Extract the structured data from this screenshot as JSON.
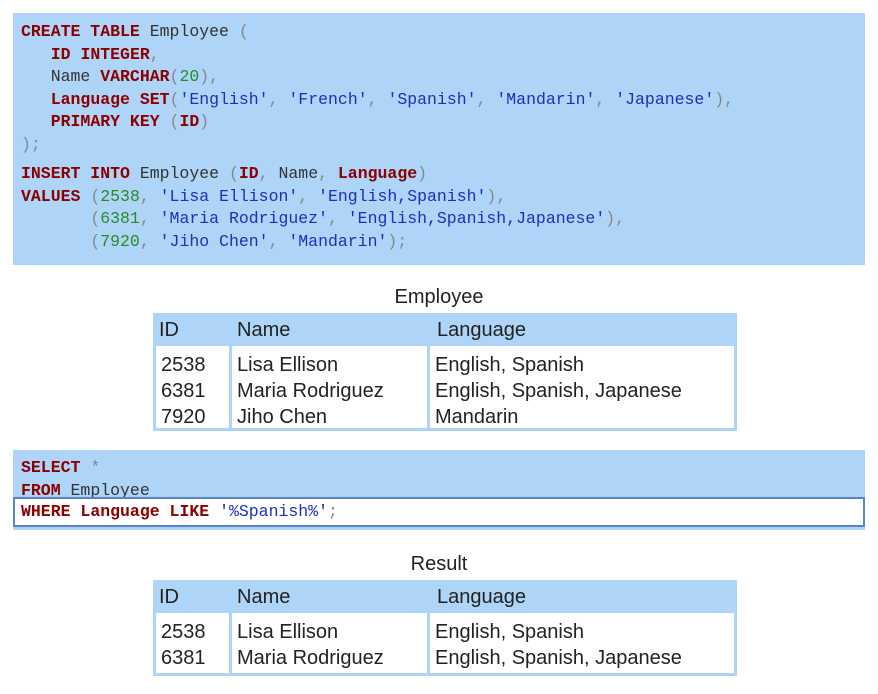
{
  "create_statement": {
    "lines": [
      [
        [
          "kw",
          "CREATE TABLE"
        ],
        [
          "plain",
          " Employee "
        ],
        [
          "punc",
          "("
        ]
      ],
      [
        [
          "plain",
          "   "
        ],
        [
          "kw",
          "ID"
        ],
        [
          "plain",
          " "
        ],
        [
          "kw",
          "INTEGER"
        ],
        [
          "punc",
          ","
        ]
      ],
      [
        [
          "plain",
          "   Name "
        ],
        [
          "kw",
          "VARCHAR"
        ],
        [
          "punc",
          "("
        ],
        [
          "num",
          "20"
        ],
        [
          "punc",
          "),"
        ]
      ],
      [
        [
          "plain",
          "   "
        ],
        [
          "kw",
          "Language"
        ],
        [
          "plain",
          " "
        ],
        [
          "kw",
          "SET"
        ],
        [
          "punc",
          "("
        ],
        [
          "str",
          "'English'"
        ],
        [
          "punc",
          ", "
        ],
        [
          "str",
          "'French'"
        ],
        [
          "punc",
          ", "
        ],
        [
          "str",
          "'Spanish'"
        ],
        [
          "punc",
          ", "
        ],
        [
          "str",
          "'Mandarin'"
        ],
        [
          "punc",
          ", "
        ],
        [
          "str",
          "'Japanese'"
        ],
        [
          "punc",
          "),"
        ]
      ],
      [
        [
          "plain",
          "   "
        ],
        [
          "kw",
          "PRIMARY KEY"
        ],
        [
          "plain",
          " "
        ],
        [
          "punc",
          "("
        ],
        [
          "kw",
          "ID"
        ],
        [
          "punc",
          ")"
        ]
      ],
      [
        [
          "punc",
          ");"
        ]
      ]
    ]
  },
  "insert_statement": {
    "lines": [
      [
        [
          "kw",
          "INSERT INTO"
        ],
        [
          "plain",
          " Employee "
        ],
        [
          "punc",
          "("
        ],
        [
          "kw",
          "ID"
        ],
        [
          "punc",
          ", "
        ],
        [
          "plain",
          "Name"
        ],
        [
          "punc",
          ", "
        ],
        [
          "kw",
          "Language"
        ],
        [
          "punc",
          ")"
        ]
      ],
      [
        [
          "kw",
          "VALUES"
        ],
        [
          "plain",
          " "
        ],
        [
          "punc",
          "("
        ],
        [
          "num",
          "2538"
        ],
        [
          "punc",
          ", "
        ],
        [
          "str",
          "'Lisa Ellison'"
        ],
        [
          "punc",
          ", "
        ],
        [
          "str",
          "'English,Spanish'"
        ],
        [
          "punc",
          "),"
        ]
      ],
      [
        [
          "plain",
          "       "
        ],
        [
          "punc",
          "("
        ],
        [
          "num",
          "6381"
        ],
        [
          "punc",
          ", "
        ],
        [
          "str",
          "'Maria Rodriguez'"
        ],
        [
          "punc",
          ", "
        ],
        [
          "str",
          "'English,Spanish,Japanese'"
        ],
        [
          "punc",
          "),"
        ]
      ],
      [
        [
          "plain",
          "       "
        ],
        [
          "punc",
          "("
        ],
        [
          "num",
          "7920"
        ],
        [
          "punc",
          ", "
        ],
        [
          "str",
          "'Jiho Chen'"
        ],
        [
          "punc",
          ", "
        ],
        [
          "str",
          "'Mandarin'"
        ],
        [
          "punc",
          ");"
        ]
      ]
    ]
  },
  "employee_table": {
    "caption": "Employee",
    "headers": [
      "ID",
      "Name",
      "Language"
    ],
    "ids": [
      "2538",
      "6381",
      "7920"
    ],
    "names": [
      "Lisa Ellison",
      "Maria Rodriguez",
      "Jiho Chen"
    ],
    "languages": [
      "English, Spanish",
      "English, Spanish, Japanese",
      "Mandarin"
    ]
  },
  "select_statement": {
    "lines": [
      [
        [
          "kw",
          "SELECT"
        ],
        [
          "plain",
          " "
        ],
        [
          "punc",
          "*"
        ]
      ],
      [
        [
          "kw",
          "FROM"
        ],
        [
          "plain",
          " Employee"
        ]
      ]
    ],
    "highlighted_line": [
      [
        "kw",
        "WHERE"
      ],
      [
        "plain",
        " "
      ],
      [
        "kw",
        "Language"
      ],
      [
        "plain",
        " "
      ],
      [
        "kw",
        "LIKE"
      ],
      [
        "plain",
        " "
      ],
      [
        "str",
        "'%Spanish%'"
      ],
      [
        "punc",
        ";"
      ]
    ]
  },
  "result_table": {
    "caption": "Result",
    "headers": [
      "ID",
      "Name",
      "Language"
    ],
    "ids": [
      "2538",
      "6381"
    ],
    "names": [
      "Lisa Ellison",
      "Maria Rodriguez"
    ],
    "languages": [
      "English, Spanish",
      "English, Spanish, Japanese"
    ]
  }
}
